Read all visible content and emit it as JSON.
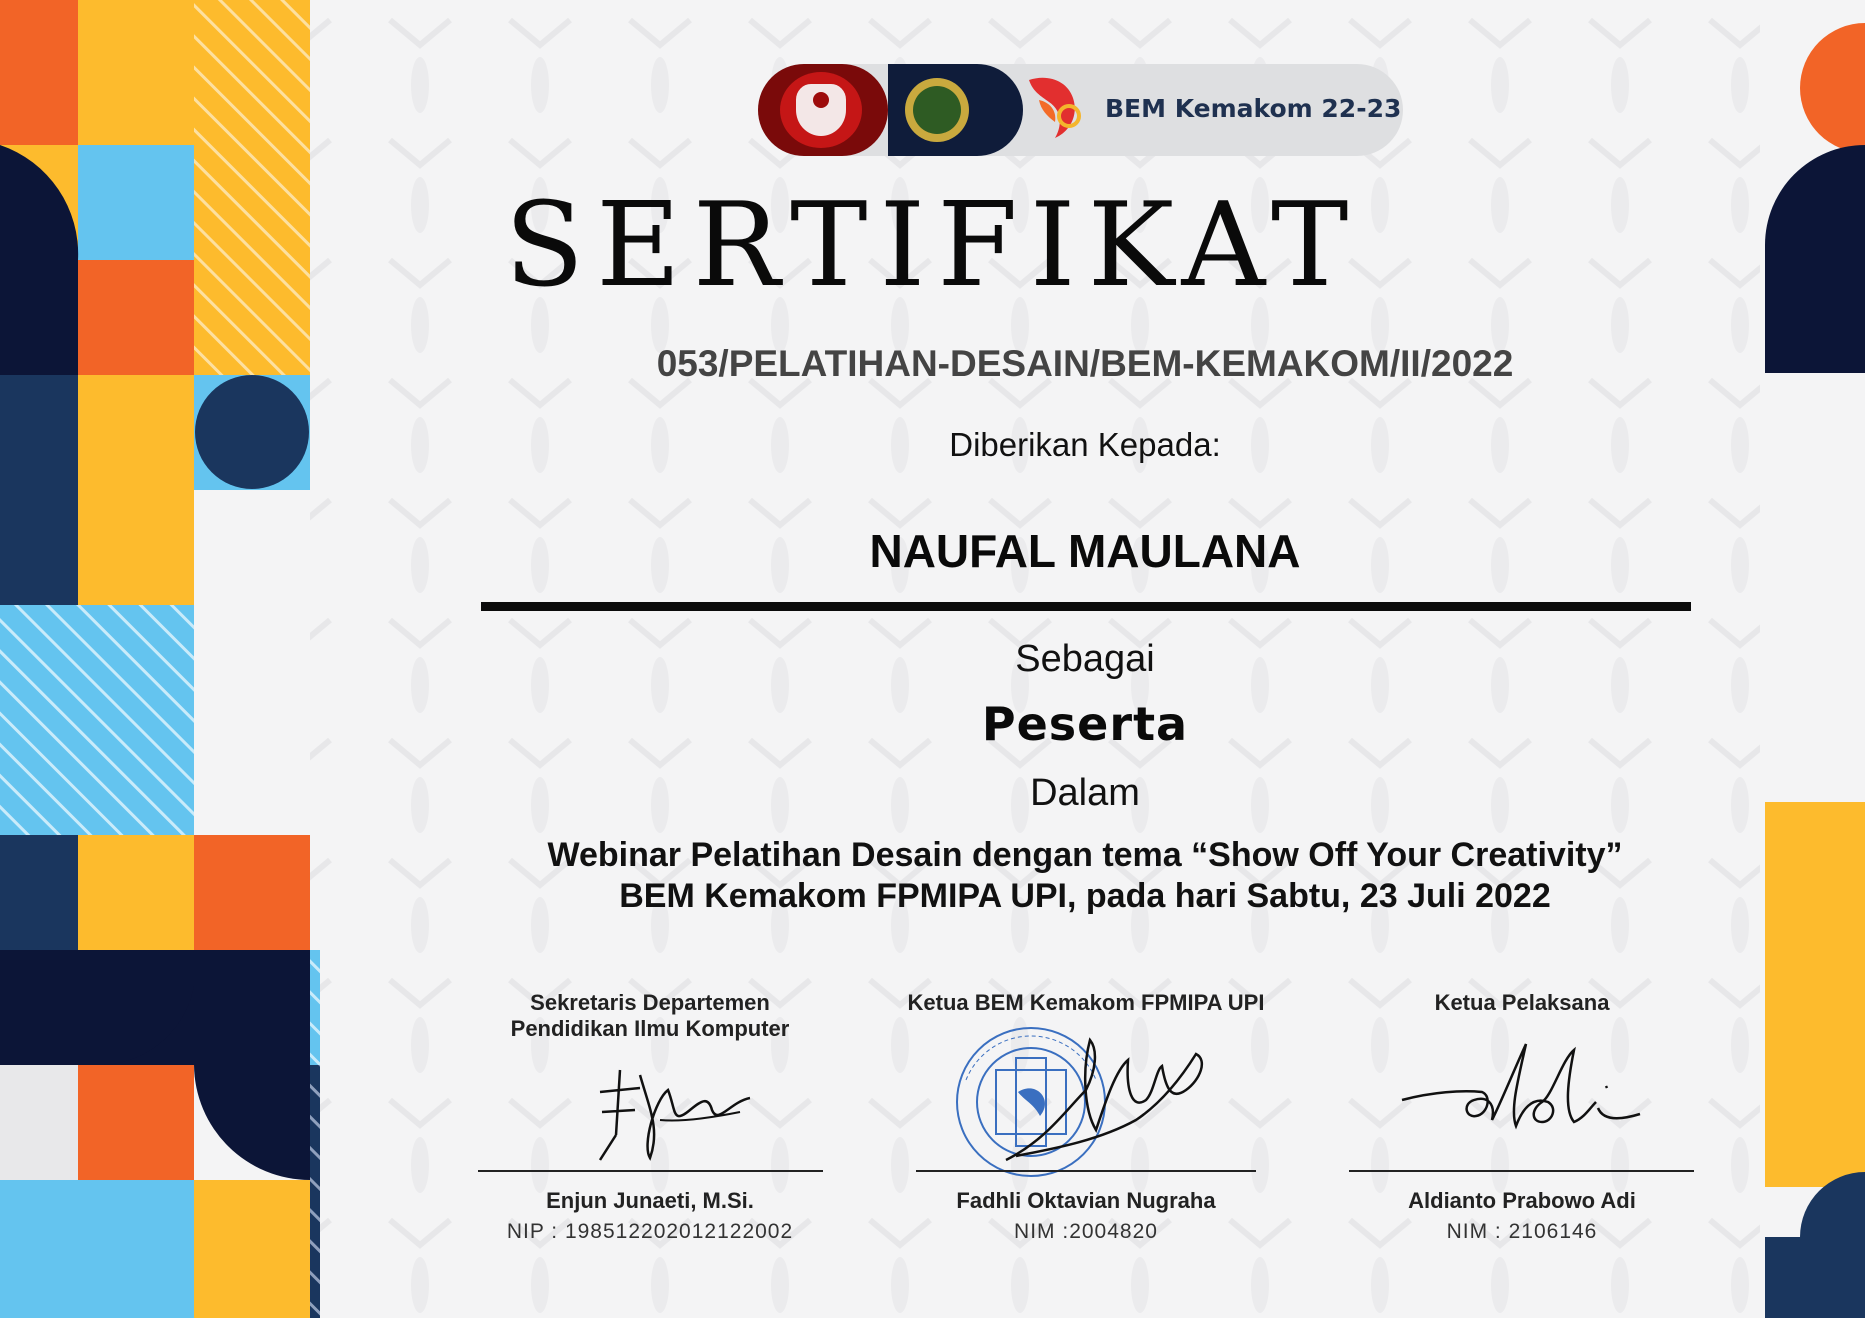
{
  "header": {
    "org_name": "BEM Kemakom 22-23",
    "logos": [
      "upi-logo",
      "hmps-logo",
      "bem-kemakom-logo"
    ]
  },
  "certificate": {
    "title": "SERTIFIKAT",
    "number": "053/PELATIHAN-DESAIN/BEM-KEMAKOM/II/2022",
    "given_to_label": "Diberikan Kepada:",
    "recipient": "NAUFAL MAULANA",
    "as_label": "Sebagai",
    "role": "Peserta",
    "in_label": "Dalam",
    "event_line1": "Webinar Pelatihan Desain dengan tema “Show Off Your Creativity”",
    "event_line2": "BEM Kemakom FPMIPA UPI, pada hari Sabtu, 23 Juli 2022"
  },
  "signatories": [
    {
      "title_line1": "Sekretaris Departemen",
      "title_line2": "Pendidikan Ilmu Komputer",
      "name": "Enjun Junaeti, M.Si.",
      "id": "NIP : 198512202012122002"
    },
    {
      "title_line1": "Ketua BEM Kemakom FPMIPA UPI",
      "title_line2": "",
      "name": "Fadhli Oktavian Nugraha",
      "id": "NIM :2004820",
      "stamp_text": "BADAN EKSEKUTIF MAHASISWA KEMAKOM FPMIPA UPI"
    },
    {
      "title_line1": "Ketua Pelaksana",
      "title_line2": "",
      "name": "Aldianto Prabowo Adi",
      "id": "NIM : 2106146"
    }
  ],
  "colors": {
    "orange": "#f26427",
    "yellow": "#fdbb2d",
    "light_blue": "#64c4ef",
    "navy": "#0c1537",
    "dark_blue": "#1a365e",
    "stamp_blue": "#3a6fc0"
  }
}
